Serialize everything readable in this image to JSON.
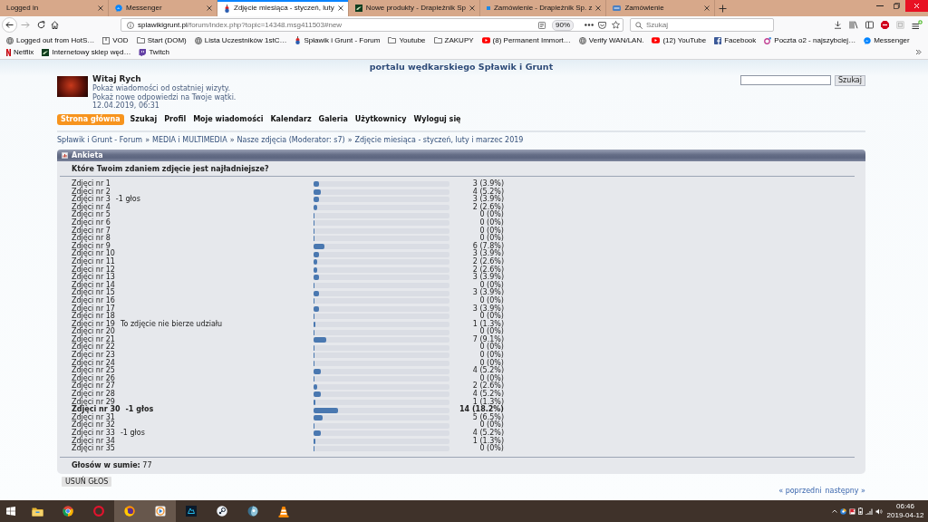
{
  "browser": {
    "tabs": [
      {
        "title": "Logged in",
        "selected": false
      },
      {
        "title": "Messenger",
        "selected": false
      },
      {
        "title": "Zdjęcie miesiąca - styczeń, luty",
        "selected": true
      },
      {
        "title": "Nowe produkty - Drapieżnik Sp",
        "selected": false
      },
      {
        "title": "Zamówienie - Drapieżnik Sp. z",
        "selected": false
      },
      {
        "title": "Zamówienie",
        "selected": false
      }
    ],
    "address": {
      "host": "splawikigrunt.pl",
      "path": "/forum/index.php?topic=14348.msg411503#new"
    },
    "zoom": "90%",
    "search": {
      "placeholder": "Szukaj"
    },
    "bookmarks": [
      {
        "label": "Logged out from HotS…",
        "kind": "link"
      },
      {
        "label": "VOD",
        "kind": "link"
      },
      {
        "label": "Start (DOM)",
        "kind": "folder"
      },
      {
        "label": "Lista Uczestników 1stC…",
        "kind": "link"
      },
      {
        "label": "Spławik i Grunt - Forum",
        "kind": "link"
      },
      {
        "label": "Youtube",
        "kind": "folder"
      },
      {
        "label": "ZAKUPY",
        "kind": "folder"
      },
      {
        "label": "(8) Permanent Immort…",
        "kind": "link"
      },
      {
        "label": "Verify WAN/LAN.",
        "kind": "link"
      },
      {
        "label": "(12) YouTube",
        "kind": "link"
      },
      {
        "label": "Facebook",
        "kind": "link"
      },
      {
        "label": "Poczta o2 - najszybciej…",
        "kind": "link"
      },
      {
        "label": "Messenger",
        "kind": "link"
      },
      {
        "label": "Netflix",
        "kind": "link"
      },
      {
        "label": "Internetowy sklep węd…",
        "kind": "link"
      },
      {
        "label": "Twitch",
        "kind": "link"
      }
    ]
  },
  "page": {
    "site_title": "portalu wędkarskiego Spławik i Grunt",
    "user": {
      "greeting": "Witaj Rych",
      "links": [
        "Pokaż wiadomości od ostatniej wizyty.",
        "Pokaż nowe odpowiedzi na Twoje wątki."
      ],
      "date": "12.04.2019, 06:31"
    },
    "search_button": "Szukaj",
    "menu": [
      {
        "label": "Strona główna",
        "selected": true
      },
      {
        "label": "Szukaj",
        "selected": false
      },
      {
        "label": "Profil",
        "selected": false
      },
      {
        "label": "Moje wiadomości",
        "selected": false
      },
      {
        "label": "Kalendarz",
        "selected": false
      },
      {
        "label": "Galeria",
        "selected": false
      },
      {
        "label": "Użytkownicy",
        "selected": false
      },
      {
        "label": "Wyloguj się",
        "selected": false
      }
    ],
    "breadcrumb": [
      {
        "label": "Spławik i Grunt - Forum",
        "separator": "»"
      },
      {
        "label": "MEDIA i MULTIMEDIA",
        "separator": "»"
      },
      {
        "label": "Nasze zdjęcia (Moderator: s7)",
        "separator": "»"
      },
      {
        "label": "Zdjęcie miesiąca - styczeń, luty i marzec 2019"
      }
    ],
    "poll": {
      "title": "Ankieta",
      "question": "Które Twoim zdaniem zdjęcie jest najładniejsze?",
      "options": [
        {
          "label": "Zdjęci nr 1",
          "level": 0.039,
          "result": "3 (3.9%)",
          "winner": false
        },
        {
          "label": "Zdjęci nr 2",
          "level": 0.052,
          "result": "4 (5.2%)",
          "winner": false
        },
        {
          "label": "Zdjęci nr 3",
          "note": "-1 głos",
          "level": 0.039,
          "result": "3 (3.9%)",
          "winner": false
        },
        {
          "label": "Zdjęci nr 4",
          "level": 0.026,
          "result": "2 (2.6%)",
          "winner": false
        },
        {
          "label": "Zdjęci nr 5",
          "level": 0,
          "result": "0 (0%)",
          "winner": false
        },
        {
          "label": "Zdjęci nr 6",
          "level": 0,
          "result": "0 (0%)",
          "winner": false
        },
        {
          "label": "Zdjęci nr 7",
          "level": 0,
          "result": "0 (0%)",
          "winner": false
        },
        {
          "label": "Zdjęci nr 8",
          "level": 0,
          "result": "0 (0%)",
          "winner": false
        },
        {
          "label": "Zdjęci nr 9",
          "level": 0.078,
          "result": "6 (7.8%)",
          "winner": false
        },
        {
          "label": "Zdjęci nr 10",
          "level": 0.039,
          "result": "3 (3.9%)",
          "winner": false
        },
        {
          "label": "Zdjęci nr 11",
          "level": 0.026,
          "result": "2 (2.6%)",
          "winner": false
        },
        {
          "label": "Zdjęci nr 12",
          "level": 0.026,
          "result": "2 (2.6%)",
          "winner": false
        },
        {
          "label": "Zdjęci nr 13",
          "level": 0.039,
          "result": "3 (3.9%)",
          "winner": false
        },
        {
          "label": "Zdjęci nr 14",
          "level": 0,
          "result": "0 (0%)",
          "winner": false
        },
        {
          "label": "Zdjęci nr 15",
          "level": 0.039,
          "result": "3 (3.9%)",
          "winner": false
        },
        {
          "label": "Zdjęci nr 16",
          "level": 0,
          "result": "0 (0%)",
          "winner": false
        },
        {
          "label": "Zdjęci nr 17",
          "level": 0.039,
          "result": "3 (3.9%)",
          "winner": false
        },
        {
          "label": "Zdjęci nr 18",
          "level": 0,
          "result": "0 (0%)",
          "winner": false
        },
        {
          "label": "Zdjęci nr 19",
          "note": "To zdjęcie nie bierze udziału",
          "level": 0.013,
          "result": "1 (1.3%)",
          "winner": false
        },
        {
          "label": "Zdjęci nr 20",
          "level": 0,
          "result": "0 (0%)",
          "winner": false
        },
        {
          "label": "Zdjęci nr 21",
          "level": 0.091,
          "result": "7 (9.1%)",
          "winner": false
        },
        {
          "label": "Zdjęci nr 22",
          "level": 0,
          "result": "0 (0%)",
          "winner": false
        },
        {
          "label": "Zdjęci nr 23",
          "level": 0,
          "result": "0 (0%)",
          "winner": false
        },
        {
          "label": "Zdjęci nr 24",
          "level": 0,
          "result": "0 (0%)",
          "winner": false
        },
        {
          "label": "Zdjęci nr 25",
          "level": 0.052,
          "result": "4 (5.2%)",
          "winner": false
        },
        {
          "label": "Zdjęci nr 26",
          "level": 0,
          "result": "0 (0%)",
          "winner": false
        },
        {
          "label": "Zdjęci nr 27",
          "level": 0.026,
          "result": "2 (2.6%)",
          "winner": false
        },
        {
          "label": "Zdjęci nr 28",
          "level": 0.052,
          "result": "4 (5.2%)",
          "winner": false
        },
        {
          "label": "Zdjęci nr 29",
          "level": 0.013,
          "result": "1 (1.3%)",
          "winner": false
        },
        {
          "label": "Zdjęci nr 30",
          "note": "-1 głos",
          "level": 0.182,
          "result": "14 (18.2%)",
          "winner": true
        },
        {
          "label": "Zdjęci nr 31",
          "level": 0.065,
          "result": "5 (6.5%)",
          "winner": false
        },
        {
          "label": "Zdjęci nr 32",
          "level": 0,
          "result": "0 (0%)",
          "winner": false
        },
        {
          "label": "Zdjęci nr 33",
          "note": "-1 głos",
          "level": 0.052,
          "result": "4 (5.2%)",
          "winner": false
        },
        {
          "label": "Zdjęci nr 34",
          "level": 0.013,
          "result": "1 (1.3%)",
          "winner": false
        },
        {
          "label": "Zdjęci nr 35",
          "level": 0,
          "result": "0 (0%)",
          "winner": false
        }
      ],
      "total": "**Głosów w sumie:** 77"
    },
    "remove_vote_button": "USUŃ GŁOS",
    "pagination": {
      "previous": "« poprzedni",
      "next": "następny »"
    }
  },
  "taskbar": {
    "apps": [
      {
        "highlighted": false
      },
      {
        "highlighted": false
      },
      {
        "highlighted": false
      },
      {
        "highlighted": true
      },
      {
        "highlighted": true
      },
      {
        "highlighted": false
      },
      {
        "highlighted": false
      },
      {
        "highlighted": false
      },
      {
        "highlighted": false
      }
    ],
    "clock": {
      "time": "06:46",
      "date": "2019-04-12"
    }
  }
}
